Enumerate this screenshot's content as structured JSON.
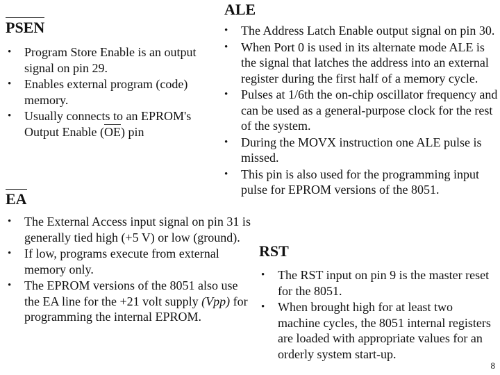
{
  "slide": {
    "page_number": "8",
    "psen": {
      "title": "PSEN",
      "bullets": [
        "Program Store Enable is an output signal on pin 29.",
        "Enables external program (code) memory."
      ],
      "bullet3_pre": "Usually connects to an EPROM's Output Enable (",
      "bullet3_ol": "OE",
      "bullet3_post": ") pin"
    },
    "ale": {
      "title": "ALE",
      "bullets": [
        "The Address Latch Enable output signal on pin 30.",
        "When Port 0 is used in its alternate mode ALE is the signal that latches the address into an external register during the first half of a memory cycle.",
        "Pulses at 1/6th the on-chip oscillator frequency and can be used as a general-purpose clock for the rest of the system.",
        "During the MOVX instruction one ALE pulse is missed.",
        "This pin is also used for the programming input pulse for EPROM versions of the 8051."
      ]
    },
    "ea": {
      "title": "EA",
      "bullets": [
        "The External Access input signal on pin 31 is generally tied high (+5 V) or low (ground).",
        "If low, programs execute from external memory only."
      ],
      "bullet3_pre": "The EPROM versions of the 8051 also use the EA line for the +21 volt supply ",
      "bullet3_italic": "(Vpp)",
      "bullet3_post": " for programming the internal EPROM."
    },
    "rst": {
      "title": "RST",
      "bullets": [
        "The RST input on pin 9 is the master reset for the 8051.",
        "When brought high for at least two machine cycles, the 8051 internal registers are loaded with appropriate values for an orderly system start-up."
      ]
    }
  }
}
